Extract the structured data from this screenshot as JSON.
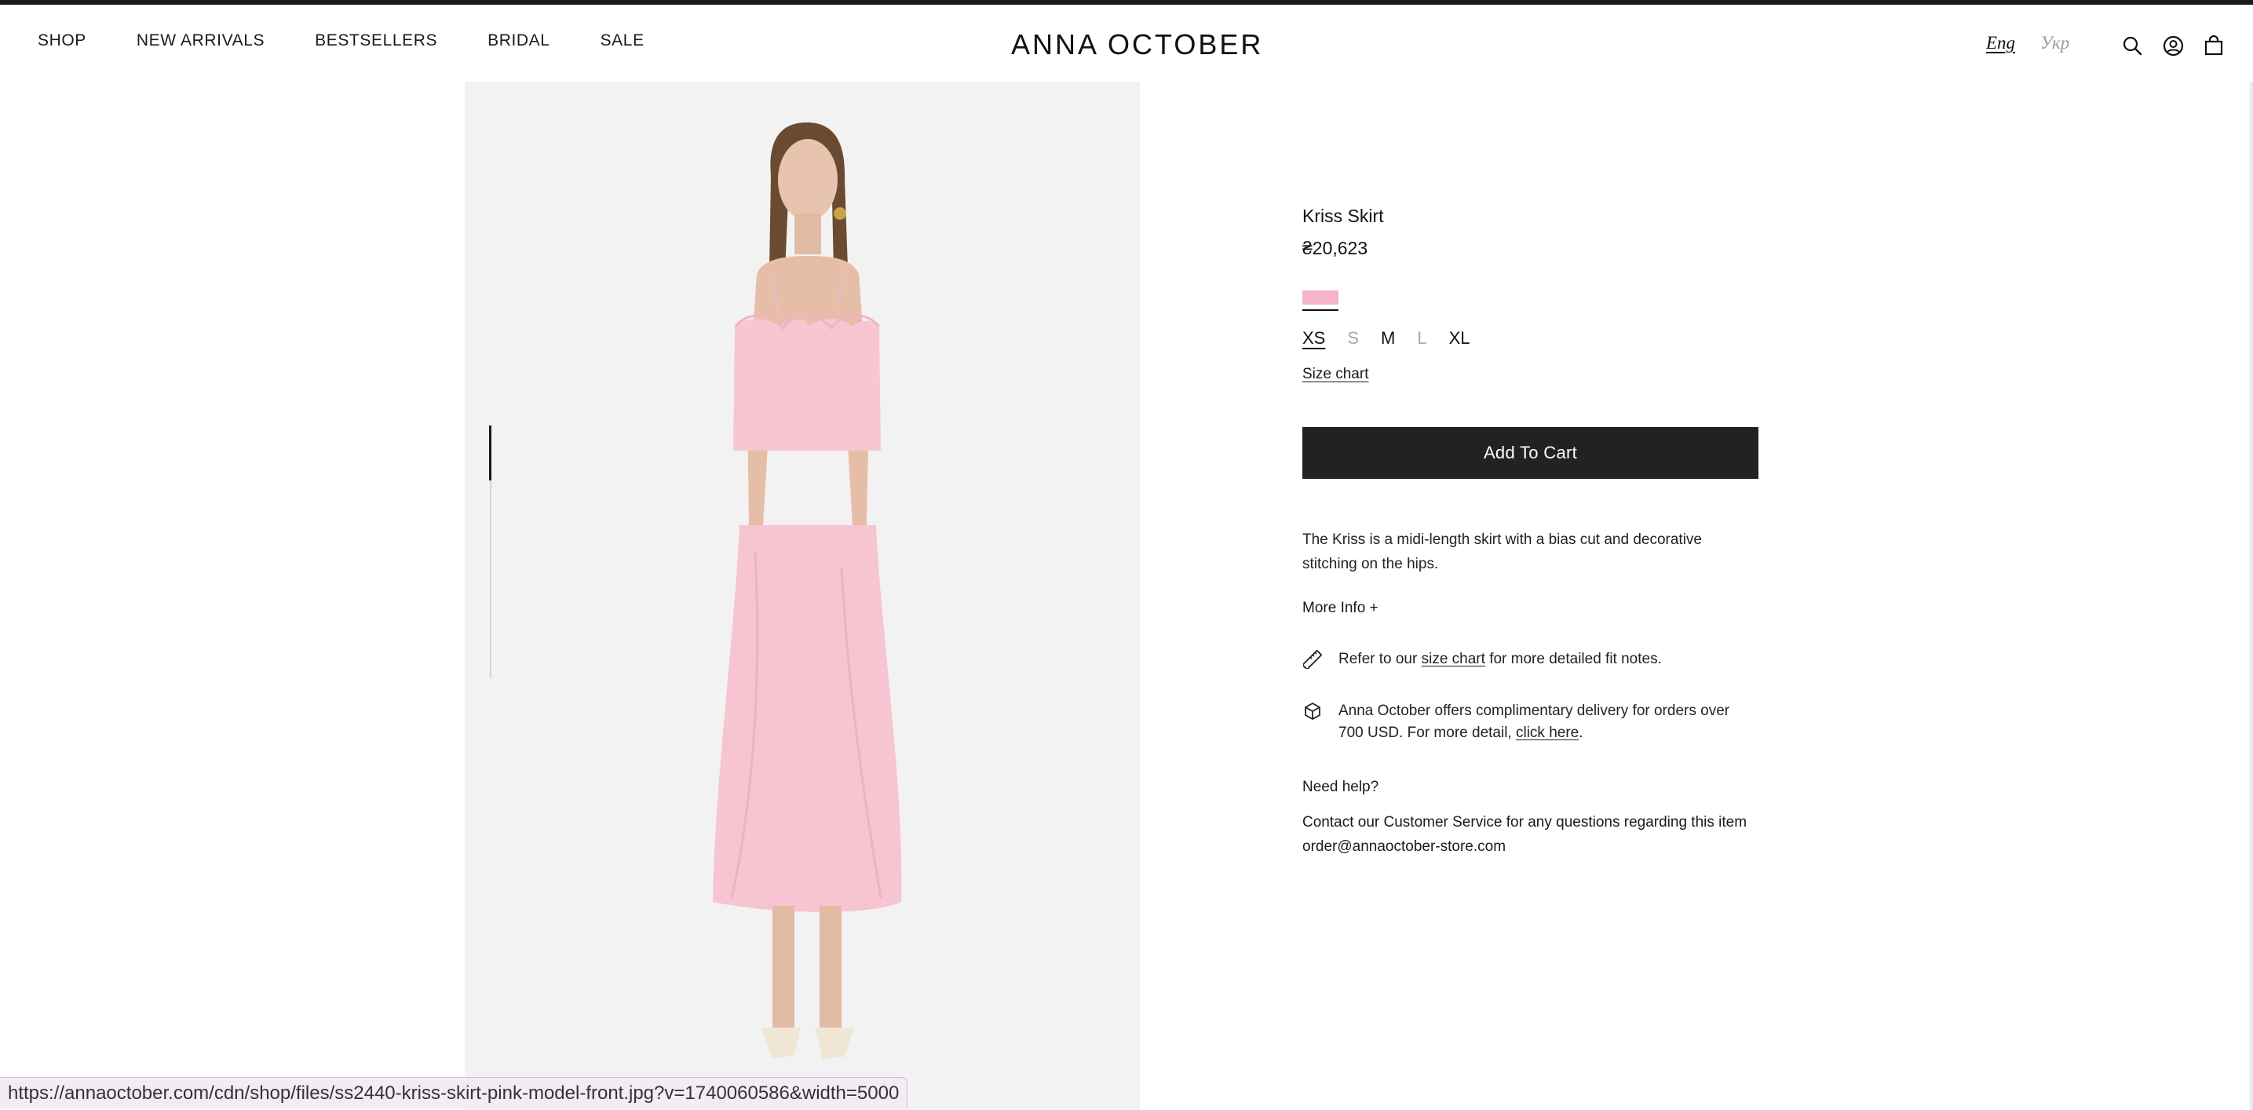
{
  "nav": {
    "items": [
      "SHOP",
      "NEW ARRIVALS",
      "BESTSELLERS",
      "BRIDAL",
      "SALE"
    ],
    "logo": "ANNA OCTOBER",
    "lang_active": "Eng",
    "lang_other": "Укр",
    "icons": [
      "search-icon",
      "account-icon",
      "bag-icon"
    ]
  },
  "product": {
    "title": "Kriss Skirt",
    "price": "₴20,623",
    "swatch_color": "#f6b5c8",
    "sizes": [
      {
        "label": "XS",
        "state": "selected"
      },
      {
        "label": "S",
        "state": "unavailable"
      },
      {
        "label": "M",
        "state": "available"
      },
      {
        "label": "L",
        "state": "unavailable"
      },
      {
        "label": "XL",
        "state": "available"
      }
    ],
    "size_chart_label": "Size chart",
    "add_to_cart_label": "Add To Cart",
    "description": "The Kriss is a midi-length skirt with a bias cut and decorative stitching on the hips.",
    "more_info_label": "More Info +",
    "fit_note": {
      "prefix": "Refer to our ",
      "link": "size chart",
      "suffix": " for more detailed fit notes."
    },
    "delivery_note": {
      "prefix": "Anna October offers complimentary delivery for orders over 700 USD. For more detail, ",
      "link": "click here",
      "suffix": "."
    },
    "help_title": "Need help?",
    "help_text": "Contact our Customer Service for any questions regarding this item order@annaoctober-store.com"
  },
  "status_bar": {
    "url": "https://annaoctober.com/cdn/shop/files/ss2440-kriss-skirt-pink-model-front.jpg?v=1740060586&width=5000"
  }
}
